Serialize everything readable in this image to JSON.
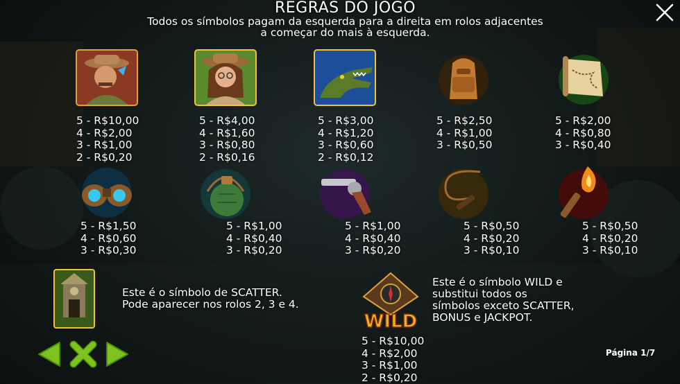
{
  "title": "REGRAS DO JOGO",
  "subtitle": [
    "Todos os símbolos pagam da esquerda para a direita em rolos adjacentes",
    "a começar do mais à esquerda."
  ],
  "symbols": [
    {
      "icon": "explorer-man-icon",
      "pays": [
        "5 - R$10,00",
        "4 - R$2,00",
        "3 - R$1,00",
        "2 - R$0,20"
      ]
    },
    {
      "icon": "explorer-woman-icon",
      "pays": [
        "5 - R$4,00",
        "4 - R$1,60",
        "3 - R$0,80",
        "2 - R$0,16"
      ]
    },
    {
      "icon": "crocodile-icon",
      "pays": [
        "5 - R$3,00",
        "4 - R$1,20",
        "3 - R$0,60",
        "2 - R$0,12"
      ]
    },
    {
      "icon": "backpack-icon",
      "pays": [
        "5 - R$2,50",
        "4 - R$1,00",
        "3 - R$0,50"
      ]
    },
    {
      "icon": "map-scroll-icon",
      "pays": [
        "5 - R$2,00",
        "4 - R$0,80",
        "3 - R$0,40"
      ]
    },
    {
      "icon": "binoculars-icon",
      "pays": [
        "5 - R$1,50",
        "4 - R$0,60",
        "3 - R$0,30"
      ]
    },
    {
      "icon": "canteen-icon",
      "pays": [
        "5 - R$1,00",
        "4 - R$0,40",
        "3 - R$0,20"
      ]
    },
    {
      "icon": "revolver-icon",
      "pays": [
        "5 - R$1,00",
        "4 - R$0,40",
        "3 - R$0,20"
      ]
    },
    {
      "icon": "whip-icon",
      "pays": [
        "5 - R$0,50",
        "4 - R$0,20",
        "3 - R$0,10"
      ]
    },
    {
      "icon": "torch-icon",
      "pays": [
        "5 - R$0,50",
        "4 - R$0,20",
        "3 - R$0,10"
      ]
    }
  ],
  "scatter": {
    "icon": "temple-scatter-icon",
    "lines": [
      "Este é o símbolo de SCATTER.",
      "Pode aparecer nos rolos 2, 3 e 4."
    ]
  },
  "wild": {
    "icon": "wild-compass-icon",
    "logo_text": "WILD",
    "lines": [
      "Este é o símbolo WILD e",
      "substitui todos os",
      "símbolos exceto SCATTER,",
      "BONUS e JACKPOT."
    ],
    "pays": [
      "5 - R$10,00",
      "4 - R$2,00",
      "3 - R$1,00",
      "2 - R$0,20"
    ]
  },
  "pagination": "Página 1/7",
  "colors": {
    "nav_green": "#7dc21e",
    "text": "#ffffff"
  }
}
